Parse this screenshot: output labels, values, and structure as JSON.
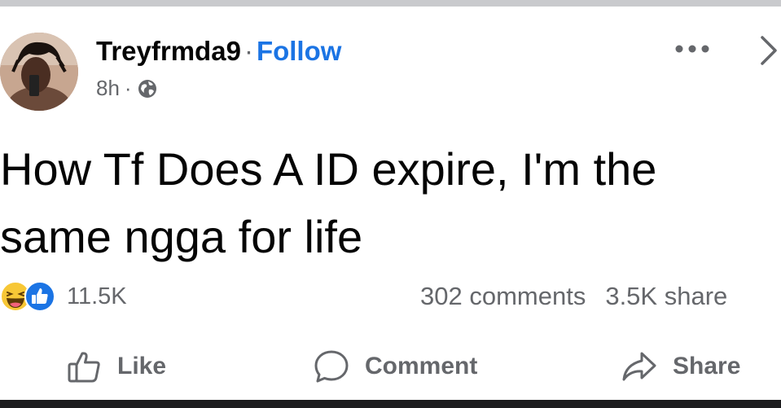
{
  "post": {
    "author": "Treyfrmda9",
    "separator": "·",
    "follow_label": "Follow",
    "time": "8h",
    "meta_separator": "·",
    "privacy_icon": "globe-icon",
    "text": "How Tf Does A ID expire, I'm the\nsame ngga for life"
  },
  "reactions": {
    "icons": [
      "haha-reaction-icon",
      "like-reaction-icon"
    ],
    "count": "11.5K"
  },
  "stats": {
    "comments": "302 comments",
    "shares": "3.5K share"
  },
  "actions": {
    "like_label": "Like",
    "comment_label": "Comment",
    "share_label": "Share"
  },
  "colors": {
    "accent": "#1b74e4",
    "secondary_text": "#65676b",
    "primary_text": "#050505"
  }
}
